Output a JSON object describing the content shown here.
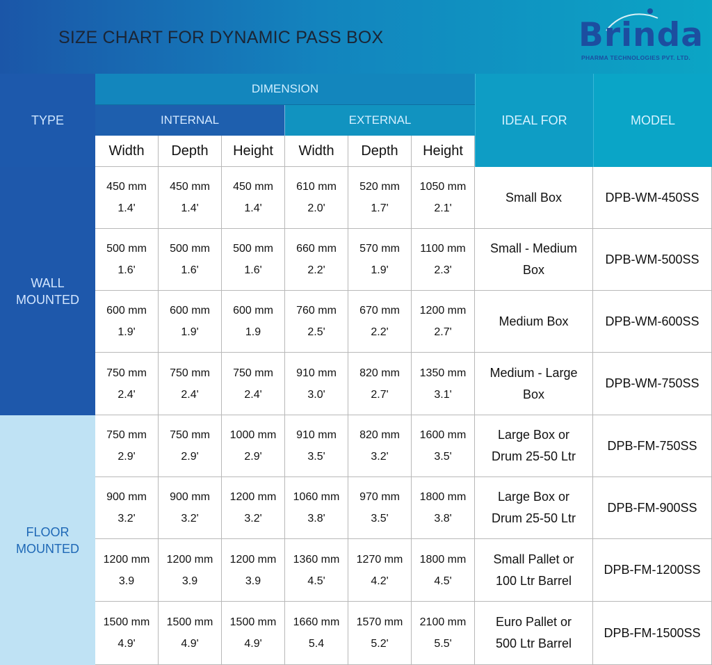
{
  "header": {
    "title": "SIZE CHART FOR DYNAMIC PASS BOX",
    "logo_word": "Brinda",
    "logo_subtitle": "PHARMA TECHNOLOGIES PVT. LTD."
  },
  "columns": {
    "type": "TYPE",
    "dimension": "DIMENSION",
    "internal": "INTERNAL",
    "external": "EXTERNAL",
    "ideal_for": "IDEAL FOR",
    "model": "MODEL",
    "sub": [
      "Width",
      "Depth",
      "Height",
      "Width",
      "Depth",
      "Height"
    ]
  },
  "groups": [
    {
      "line1": "WALL",
      "line2": "MOUNTED"
    },
    {
      "line1": "FLOOR",
      "line2": "MOUNTED"
    }
  ],
  "rows": [
    {
      "dims": [
        [
          "450 mm",
          "1.4'"
        ],
        [
          "450 mm",
          "1.4'"
        ],
        [
          "450 mm",
          "1.4'"
        ],
        [
          "610 mm",
          "2.0'"
        ],
        [
          "520 mm",
          "1.7'"
        ],
        [
          "1050 mm",
          "2.1'"
        ]
      ],
      "ideal": [
        "Small Box",
        ""
      ],
      "model": "DPB-WM-450SS"
    },
    {
      "dims": [
        [
          "500 mm",
          "1.6'"
        ],
        [
          "500 mm",
          "1.6'"
        ],
        [
          "500 mm",
          "1.6'"
        ],
        [
          "660 mm",
          "2.2'"
        ],
        [
          "570 mm",
          "1.9'"
        ],
        [
          "1100 mm",
          "2.3'"
        ]
      ],
      "ideal": [
        "Small - Medium",
        "Box"
      ],
      "model": "DPB-WM-500SS"
    },
    {
      "dims": [
        [
          "600 mm",
          "1.9'"
        ],
        [
          "600 mm",
          "1.9'"
        ],
        [
          "600 mm",
          "1.9"
        ],
        [
          "760 mm",
          "2.5'"
        ],
        [
          "670 mm",
          "2.2'"
        ],
        [
          "1200 mm",
          "2.7'"
        ]
      ],
      "ideal": [
        "Medium Box",
        ""
      ],
      "model": "DPB-WM-600SS"
    },
    {
      "dims": [
        [
          "750 mm",
          "2.4'"
        ],
        [
          "750 mm",
          "2.4'"
        ],
        [
          "750 mm",
          "2.4'"
        ],
        [
          "910 mm",
          "3.0'"
        ],
        [
          "820 mm",
          "2.7'"
        ],
        [
          "1350 mm",
          "3.1'"
        ]
      ],
      "ideal": [
        "Medium - Large",
        "Box"
      ],
      "model": "DPB-WM-750SS"
    },
    {
      "dims": [
        [
          "750 mm",
          "2.9'"
        ],
        [
          "750 mm",
          "2.9'"
        ],
        [
          "1000 mm",
          "2.9'"
        ],
        [
          "910 mm",
          "3.5'"
        ],
        [
          "820 mm",
          "3.2'"
        ],
        [
          "1600 mm",
          "3.5'"
        ]
      ],
      "ideal": [
        "Large Box or",
        "Drum 25-50 Ltr"
      ],
      "model": "DPB-FM-750SS"
    },
    {
      "dims": [
        [
          "900 mm",
          "3.2'"
        ],
        [
          "900 mm",
          "3.2'"
        ],
        [
          "1200 mm",
          "3.2'"
        ],
        [
          "1060 mm",
          "3.8'"
        ],
        [
          "970 mm",
          "3.5'"
        ],
        [
          "1800 mm",
          "3.8'"
        ]
      ],
      "ideal": [
        "Large Box or",
        "Drum 25-50 Ltr"
      ],
      "model": "DPB-FM-900SS"
    },
    {
      "dims": [
        [
          "1200 mm",
          "3.9"
        ],
        [
          "1200 mm",
          "3.9"
        ],
        [
          "1200 mm",
          "3.9"
        ],
        [
          "1360 mm",
          "4.5'"
        ],
        [
          "1270 mm",
          "4.2'"
        ],
        [
          "1800 mm",
          "4.5'"
        ]
      ],
      "ideal": [
        "Small Pallet or",
        "100 Ltr Barrel"
      ],
      "model": "DPB-FM-1200SS"
    },
    {
      "dims": [
        [
          "1500 mm",
          "4.9'"
        ],
        [
          "1500 mm",
          "4.9'"
        ],
        [
          "1500 mm",
          "4.9'"
        ],
        [
          "1660 mm",
          "5.4"
        ],
        [
          "1570 mm",
          "5.2'"
        ],
        [
          "2100 mm",
          "5.5'"
        ]
      ],
      "ideal": [
        "Euro Pallet or",
        "500 Ltr Barrel"
      ],
      "model": "DPB-FM-1500SS"
    }
  ]
}
